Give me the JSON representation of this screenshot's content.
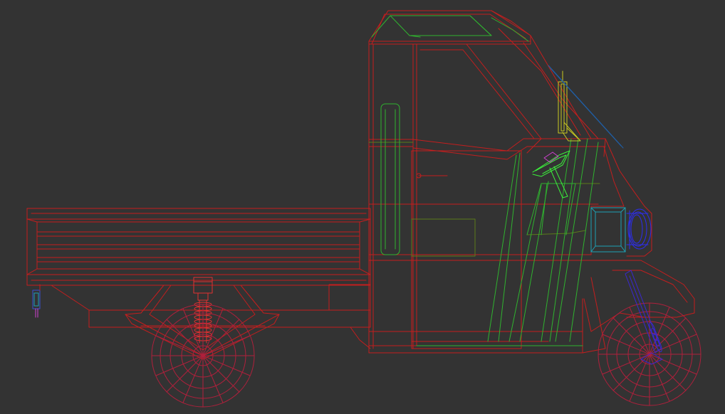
{
  "viewport": {
    "background": "#333333",
    "view": "side-wireframe",
    "subject": "three-wheeler-cargo-truck"
  },
  "colors": {
    "body": "#c41e1e",
    "cabin_glass": "#2fb32f",
    "dark_olive": "#5b7b1a",
    "seat": "#c8c820",
    "headlight": "#2d2df0",
    "headlight_lens": "#1ea0b4",
    "steering_wheel": "#3cf03c",
    "steering_hub": "#d040d0",
    "suspension": "#3a28d0",
    "wiper": "#1f5fa8",
    "wheels": "#b0203c",
    "coil_spring": "#e03030"
  },
  "icons": [
    "front-wheel-icon",
    "rear-wheel-icon",
    "steering-wheel-icon",
    "headlight-icon",
    "coil-spring-icon",
    "tail-light-icon"
  ]
}
